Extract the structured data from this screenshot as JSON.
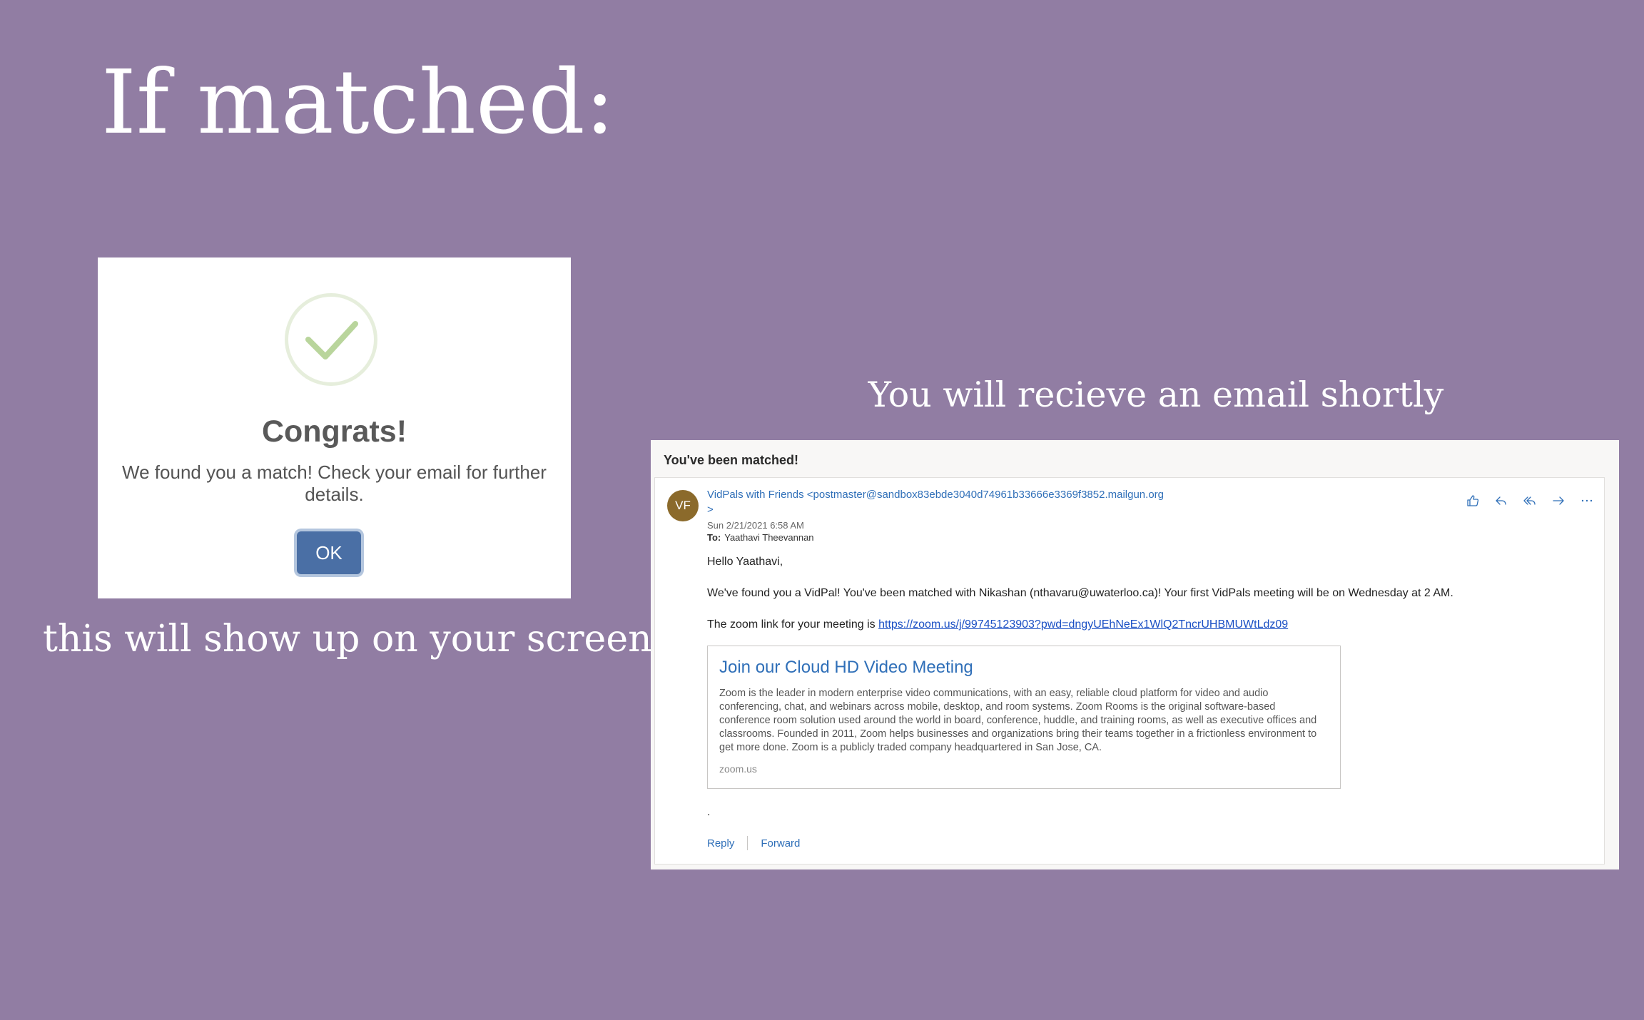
{
  "slide": {
    "title": "If matched:",
    "dialog_caption": "this will show up on your screen",
    "email_caption": "You will recieve an email shortly"
  },
  "dialog": {
    "icon": "check-icon",
    "title": "Congrats!",
    "message": "We found you a match! Check your email for further details.",
    "ok_label": "OK",
    "colors": {
      "button": "#4a6fa5",
      "check": "#b9d59c"
    }
  },
  "email": {
    "subject": "You've been matched!",
    "avatar_initials": "VF",
    "from": "VidPals with Friends <postmaster@sandbox83ebde3040d74961b33666e3369f3852.mailgun.org>",
    "date": "Sun 2/21/2021 6:58 AM",
    "to_label": "To:",
    "to": "Yaathavi Theevannan",
    "actions": [
      "like-icon",
      "reply-icon",
      "reply-all-icon",
      "forward-icon",
      "more-icon"
    ],
    "greeting": "Hello Yaathavi,",
    "body_line1": "We've found you a VidPal! You've been matched with Nikashan (nthavaru@uwaterloo.ca)! Your first VidPals meeting will be on Wednesday at 2 AM.",
    "body_line2_prefix": "The zoom link for your meeting is ",
    "zoom_link": "https://zoom.us/j/99745123903?pwd=dngyUEhNeEx1WlQ2TncrUHBMUWtLdz09",
    "preview": {
      "title": "Join our Cloud HD Video Meeting",
      "description": "Zoom is the leader in modern enterprise video communications, with an easy, reliable cloud platform for video and audio conferencing, chat, and webinars across mobile, desktop, and room systems. Zoom Rooms is the original software-based conference room solution used around the world in board, conference, huddle, and training rooms, as well as executive offices and classrooms. Founded in 2011, Zoom helps businesses and organizations bring their teams together in a frictionless environment to get more done. Zoom is a publicly traded company headquartered in San Jose, CA.",
      "domain": "zoom.us"
    },
    "trailing": ".",
    "reply_label": "Reply",
    "forward_label": "Forward"
  }
}
